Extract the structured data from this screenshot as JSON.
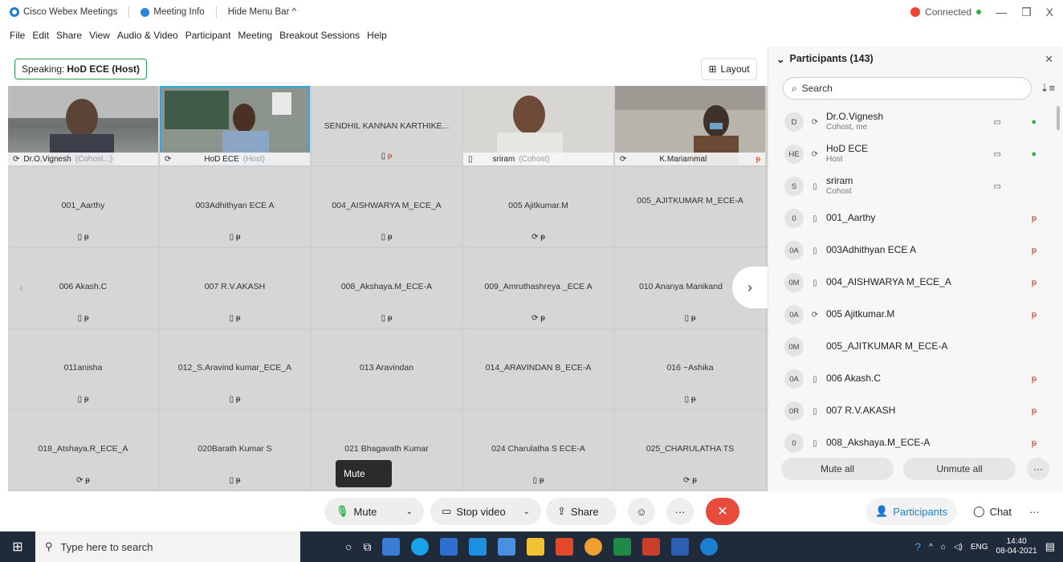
{
  "titlebar": {
    "app_name": "Cisco Webex Meetings",
    "meeting_info": "Meeting Info",
    "hide_menu": "Hide Menu Bar ^",
    "connected": "Connected",
    "minimize": "—",
    "maximize": "❐",
    "close": "X"
  },
  "menu": [
    "File",
    "Edit",
    "Share",
    "View",
    "Audio & Video",
    "Participant",
    "Meeting",
    "Breakout Sessions",
    "Help"
  ],
  "stage": {
    "speaking_label": "Speaking:",
    "speaking_name": "HoD ECE (Host)",
    "layout_label": "Layout"
  },
  "video_tiles": [
    {
      "name": "Dr.O.Vignesh",
      "role": "(Cohost...)"
    },
    {
      "name": "HoD ECE",
      "role": "(Host)"
    },
    {
      "name": "SENDHIL KANNAN KARTHIKE..."
    },
    {
      "name": "sriram",
      "role": "(Cohost)"
    },
    {
      "name": "K.Mariammal",
      "role": ""
    }
  ],
  "tiles": [
    "001_Aarthy",
    "003Adhithyan ECE A",
    "004_AISHWARYA M_ECE_A",
    "005 Ajitkumar.M",
    "005_AJITKUMAR M_ECE-A",
    "006 Akash.C",
    "007 R.V.AKASH",
    "008_Akshaya.M_ECE-A",
    "009_Amruthashreya _ECE A",
    "010 Ananya Manikand",
    "011anisha",
    "012_S.Aravind kumar_ECE_A",
    "013 Aravindan",
    "014_ARAVINDAN B_ECE-A",
    "016 ~Ashika",
    "018_Atshaya.R_ECE_A",
    "020Barath Kumar S",
    "021 Bhagavath Kumar",
    "024 Charulatha S ECE-A",
    "025_CHARULATHA TS"
  ],
  "tooltip": "Mute",
  "controls": {
    "mute": "Mute",
    "stop_video": "Stop video",
    "share": "Share",
    "more": "···",
    "participants": "Participants",
    "chat": "Chat"
  },
  "panel": {
    "title": "Participants (143)",
    "search_placeholder": "Search",
    "mute_all": "Mute all",
    "unmute_all": "Unmute all",
    "participants": [
      {
        "initials": "D",
        "name": "Dr.O.Vignesh",
        "role": "Cohost, me"
      },
      {
        "initials": "HE",
        "name": "HoD ECE",
        "role": "Host"
      },
      {
        "initials": "S",
        "name": "sriram",
        "role": "Cohost"
      },
      {
        "initials": "0",
        "name": "001_Aarthy",
        "role": ""
      },
      {
        "initials": "0A",
        "name": "003Adhithyan ECE A",
        "role": ""
      },
      {
        "initials": "0M",
        "name": "004_AISHWARYA M_ECE_A",
        "role": ""
      },
      {
        "initials": "0A",
        "name": "005 Ajitkumar.M",
        "role": ""
      },
      {
        "initials": "0M",
        "name": "005_AJITKUMAR M_ECE-A",
        "role": ""
      },
      {
        "initials": "0A",
        "name": "006 Akash.C",
        "role": ""
      },
      {
        "initials": "0R",
        "name": "007 R.V.AKASH",
        "role": ""
      },
      {
        "initials": "0",
        "name": "008_Akshaya.M_ECE-A",
        "role": ""
      }
    ]
  },
  "taskbar": {
    "search_placeholder": "Type here to search",
    "lang": "ENG",
    "time": "14:40",
    "date": "08-04-2021"
  },
  "colors": {
    "accent": "#2ea8e5",
    "end_call": "#e84a3c",
    "mic_on": "#2cb34a",
    "mic_off": "#d4402b",
    "speaking_border": "#2a9d50"
  }
}
